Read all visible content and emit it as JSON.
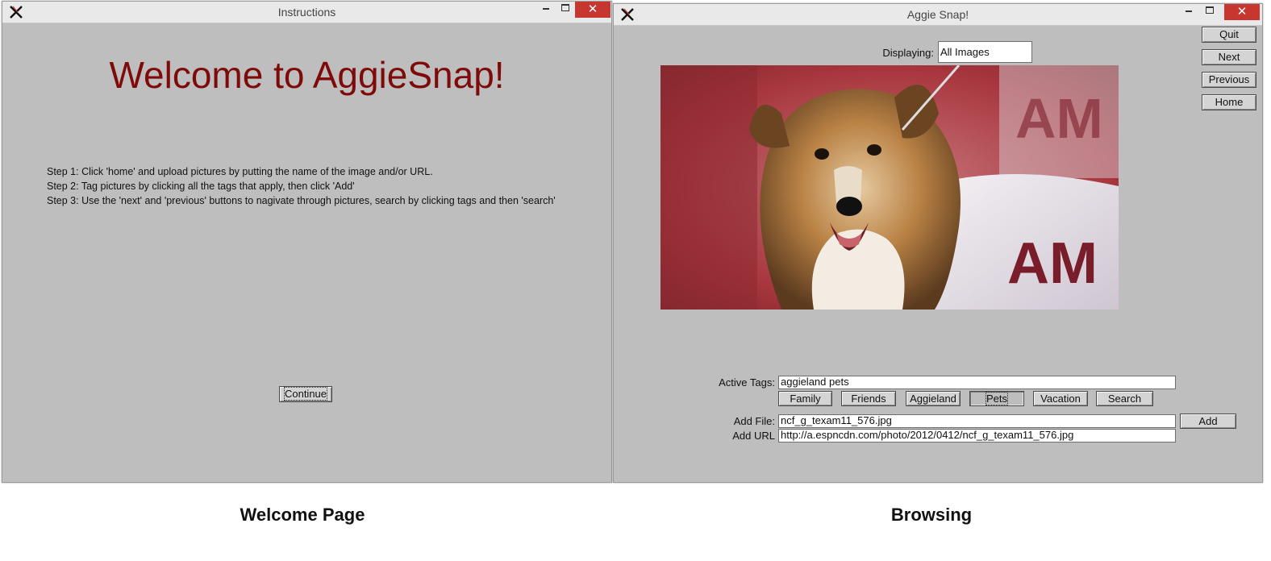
{
  "instructions_window": {
    "title": "Instructions",
    "heading": "Welcome to AggieSnap!",
    "steps": [
      "Step 1: Click 'home' and upload pictures by putting the name of the image and/or URL.",
      "Step 2: Tag pictures by clicking all the tags that apply, then click 'Add'",
      "Step 3: Use the 'next' and 'previous' buttons to nagivate through pictures, search by clicking tags and then 'search'"
    ],
    "continue_label": "Continue"
  },
  "aggie_window": {
    "title": "Aggie Snap!",
    "nav": {
      "quit": "Quit",
      "next": "Next",
      "previous": "Previous",
      "home": "Home"
    },
    "displaying_label": "Displaying:",
    "displaying_value": "All Images",
    "active_tags_label": "Active Tags:",
    "active_tags_value": "  aggieland pets",
    "tags": [
      "Family",
      "Friends",
      "Aggieland",
      "Pets",
      "Vacation"
    ],
    "search_label": "Search",
    "add_file_label": "Add File:",
    "add_file_value": "ncf_g_texam11_576.jpg",
    "add_url_label": "Add URL",
    "add_url_value": "http://a.espncdn.com/photo/2012/0412/ncf_g_texam11_576.jpg",
    "add_label": "Add"
  },
  "window_controls": {
    "close_glyph": "✕"
  },
  "captions": {
    "left": "Welcome Page",
    "right": "Browsing"
  },
  "colors": {
    "heading": "#7e0a0a",
    "window_bg": "#bebebe",
    "close": "#c7372f"
  },
  "icons": [
    "tk-feather-icon",
    "minimize-icon",
    "maximize-icon",
    "close-icon",
    "dog-photo"
  ]
}
